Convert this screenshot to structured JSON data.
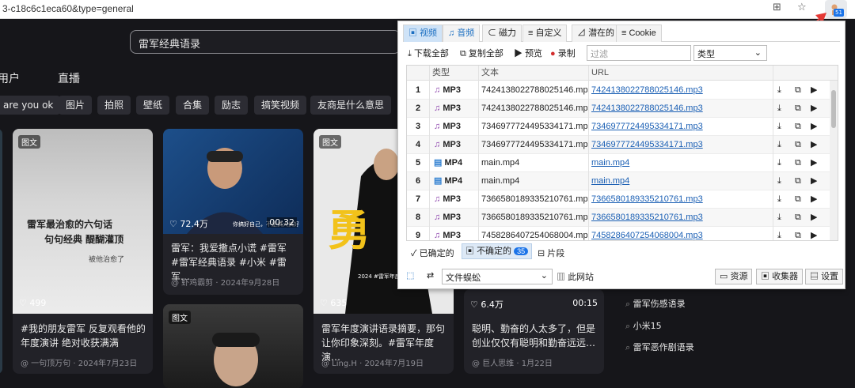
{
  "browser": {
    "url": "3-c18c6c1eca60&type=general",
    "badge": "51"
  },
  "search": {
    "value": "雷军经典语录"
  },
  "nav": {
    "users": "用户",
    "live": "直播"
  },
  "tags": [
    "are you ok",
    "图片",
    "拍照",
    "壁纸",
    "合集",
    "励志",
    "搞笑视频",
    "友商是什么意思"
  ],
  "cards": [
    {
      "overlay1": "雷军最治愈的六句话",
      "overlay2": "句句经典 醍醐灌顶",
      "overlay3": "被他治愈了",
      "likes": "499",
      "title": "#我的朋友雷军 反复观看他的年度演讲 绝对收获满满",
      "author": "@ 一句顶万句",
      "date": "2024年7月23日",
      "badge": "图文"
    },
    {
      "likes": "72.4万",
      "caption": "你搞好自己，不是搞大搞好",
      "duration": "00:32",
      "title": "雷军：我爱撒点小谎 #雷军 #雷军经典语录 #小米 #雷军…",
      "author": "@ 虾鸡霸剪",
      "date": "2024年9月28日"
    },
    {
      "badge": "图文",
      "overlay_big": "勇",
      "overlay_small": "2024 #雷军年度演讲",
      "likes": "635",
      "title": "雷军年度演讲语录摘要，那句让你印象深刻。#雷军年度演…",
      "author": "@ Ling.H",
      "date": "2024年7月19日"
    },
    {
      "likes": "6.4万",
      "duration": "00:15",
      "title": "聪明、勤奋的人太多了，但是创业仅仅有聪明和勤奋远远…",
      "author": "@ 巨人思维",
      "date": "1月22日"
    },
    {
      "badge": "图文"
    }
  ],
  "hot": [
    "雷军伤感语录",
    "小米15",
    "雷军恶作剧语录"
  ],
  "panel": {
    "tabs": [
      "视频",
      "音频",
      "磁力",
      "自定义",
      "潜在的",
      "Cookie"
    ],
    "toolbar": {
      "download_all": "下载全部",
      "copy_all": "复制全部",
      "preview": "预览",
      "record": "录制",
      "filter_placeholder": "过滤",
      "type_select": "类型"
    },
    "columns": [
      "类型",
      "文本",
      "URL"
    ],
    "rows": [
      {
        "n": "1",
        "type": "MP3",
        "text": "7424138022788025146.mp3",
        "url": "7424138022788025146.mp3"
      },
      {
        "n": "2",
        "type": "MP3",
        "text": "7424138022788025146.mp3",
        "url": "7424138022788025146.mp3"
      },
      {
        "n": "3",
        "type": "MP3",
        "text": "7346977724495334171.mp3",
        "url": "7346977724495334171.mp3"
      },
      {
        "n": "4",
        "type": "MP3",
        "text": "7346977724495334171.mp3",
        "url": "7346977724495334171.mp3"
      },
      {
        "n": "5",
        "type": "MP4",
        "text": "main.mp4",
        "url": "main.mp4"
      },
      {
        "n": "6",
        "type": "MP4",
        "text": "main.mp4",
        "url": "main.mp4"
      },
      {
        "n": "7",
        "type": "MP3",
        "text": "7366580189335210761.mp3",
        "url": "7366580189335210761.mp3"
      },
      {
        "n": "8",
        "type": "MP3",
        "text": "7366580189335210761.mp3",
        "url": "7366580189335210761.mp3"
      },
      {
        "n": "9",
        "type": "MP3",
        "text": "7458286407254068004.mp3",
        "url": "7458286407254068004.mp3"
      }
    ],
    "status": {
      "confirmed": "已确定的",
      "unconfirmed": "不确定的",
      "count": "35",
      "fragment": "片段"
    },
    "bottom": {
      "program": "文件蜈蚣",
      "this_site": "此网站",
      "resources": "资源",
      "collector": "收集器",
      "settings": "设置"
    }
  },
  "colors": {
    "accent": "#1a6ec1",
    "mp3_icon": "#8e44ad",
    "mp4_icon": "#2f7fd1",
    "arrow": "#e53935"
  }
}
